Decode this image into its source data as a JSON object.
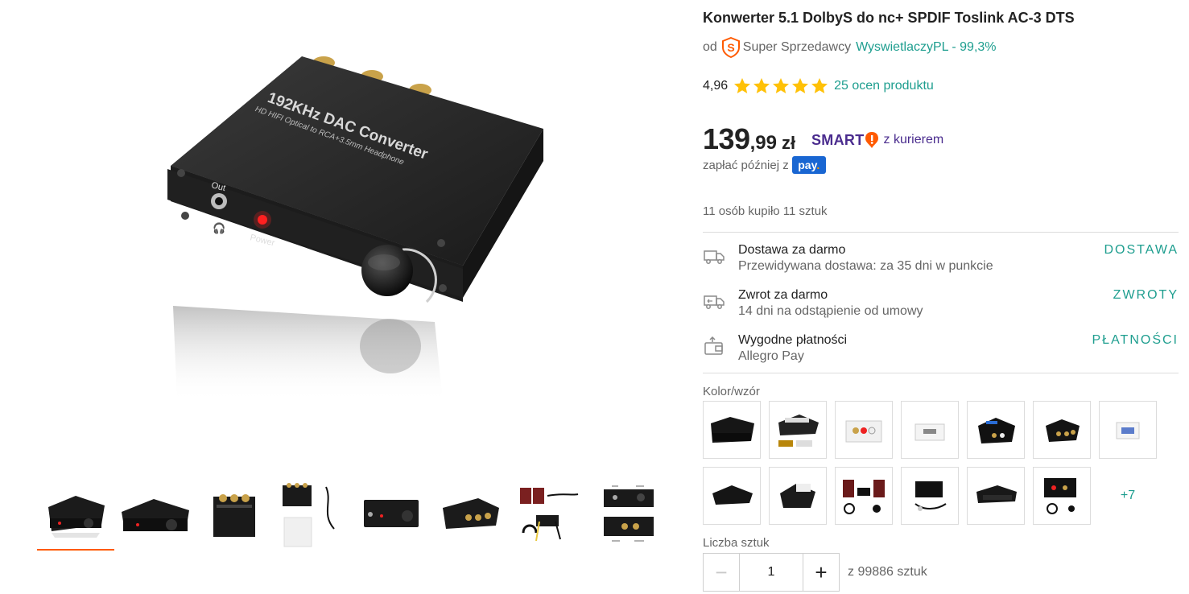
{
  "product": {
    "title": "Konwerter 5.1 DolbyS do nc+ SPDIF Toslink AC-3 DTS",
    "seller_prefix": "od",
    "seller_badge": "Super Sprzedawcy",
    "seller_name": "WyswietlaczyPL - 99,3%",
    "rating_value": "4,96",
    "rating_stars": 5,
    "rating_link": "25 ocen produktu",
    "main_image_labels": {
      "brand_line": "192KHz DAC Converter",
      "sub_line": "HD HIFI Optical to RCA+3.5mm Headphone",
      "out_label": "Out",
      "power_label": "Power"
    }
  },
  "price": {
    "integer": "139",
    "decimal": ",99",
    "currency": "zł",
    "smart_word": "SMART",
    "delivery_text": "z kurierem",
    "pay_later_text": "zapłać później z",
    "pay_badge": "pay"
  },
  "bought_text": "11 osób kupiło 11 sztuk",
  "benefits": [
    {
      "icon": "truck-icon",
      "title": "Dostawa za darmo",
      "subtitle": "Przewidywana dostawa: za 35 dni w punkcie",
      "link": "DOSTAWA"
    },
    {
      "icon": "return-truck-icon",
      "title": "Zwrot za darmo",
      "subtitle": "14 dni na odstąpienie od umowy",
      "link": "ZWROTY"
    },
    {
      "icon": "wallet-icon",
      "title": "Wygodne płatności",
      "subtitle": "Allegro Pay",
      "link": "PŁATNOŚCI"
    }
  ],
  "variants": {
    "label": "Kolor/wzór",
    "more": "+7",
    "count": 14
  },
  "quantity": {
    "label": "Liczba sztuk",
    "value": "1",
    "minus": "−",
    "plus": "+",
    "available": "z 99886 sztuk"
  },
  "gallery": {
    "thumb_count": 8,
    "active_index": 0
  },
  "colors": {
    "accent_teal": "#1e9e8f",
    "active_underline": "#ff5a00",
    "star": "#ffc107",
    "smart_purple": "#4a2c8e",
    "pay_blue": "#1966d2"
  }
}
